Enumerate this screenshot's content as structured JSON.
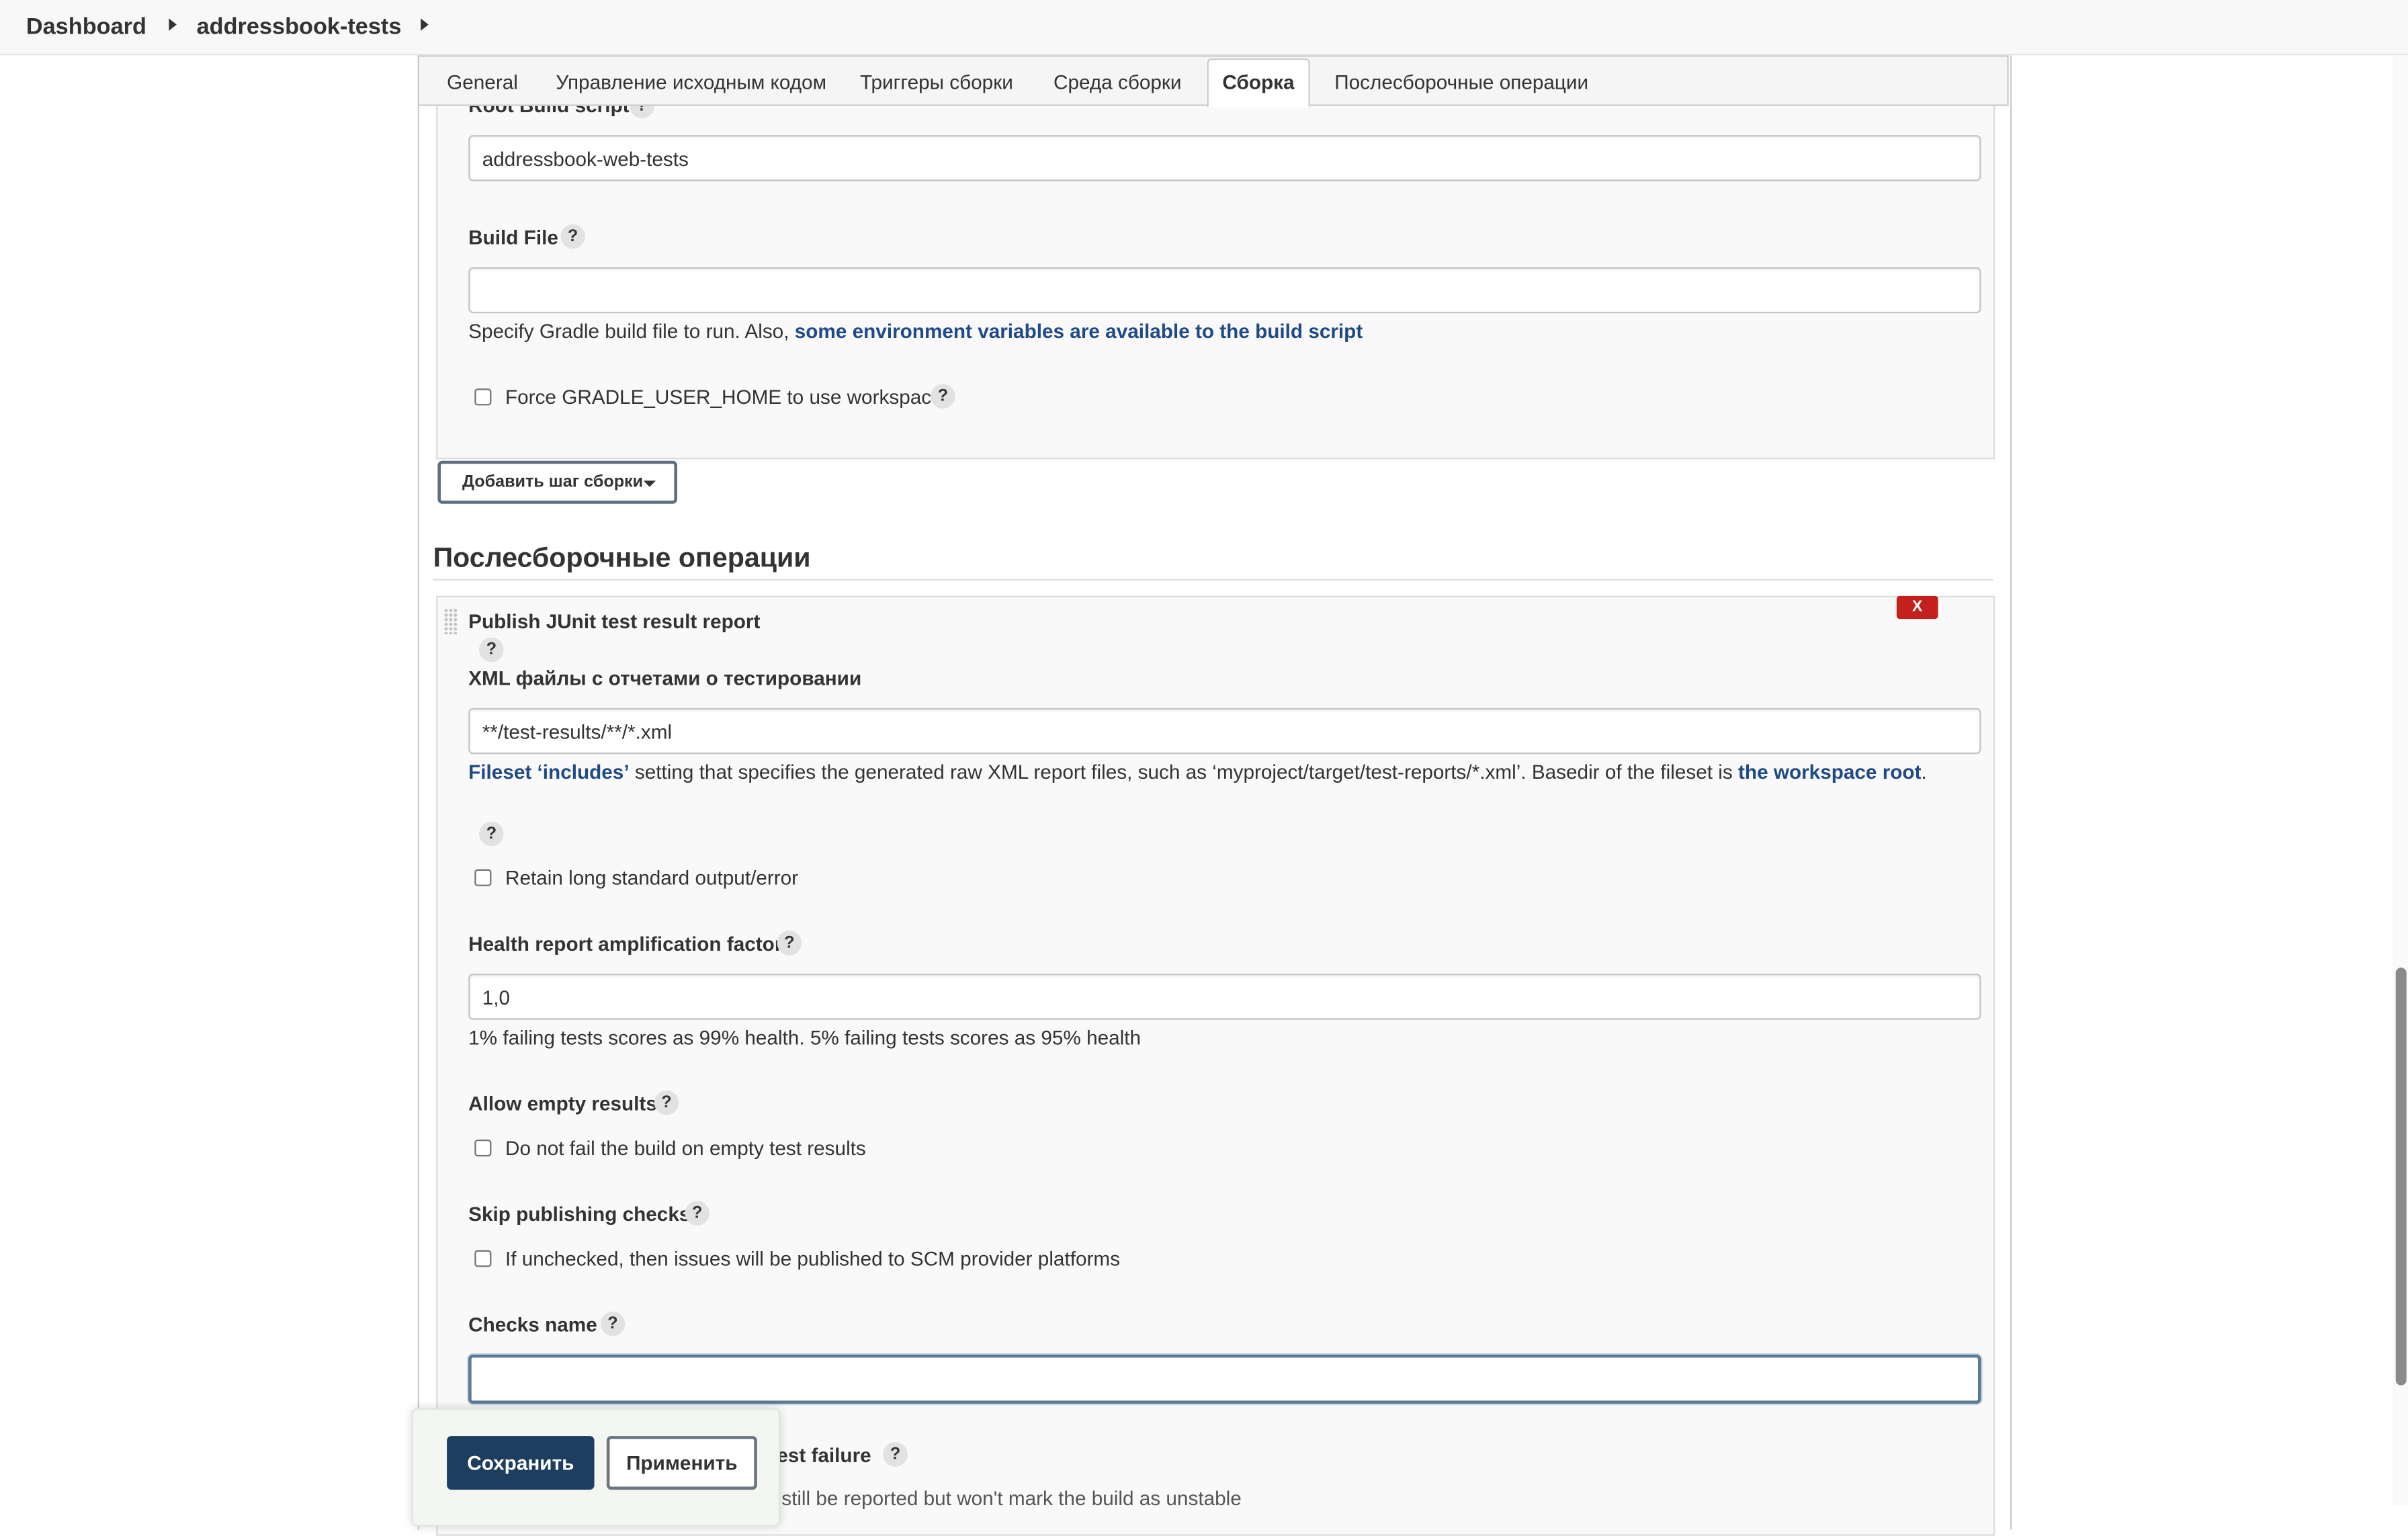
{
  "breadcrumb": {
    "items": [
      "Dashboard",
      "addressbook-tests"
    ]
  },
  "tabs": [
    {
      "label": "General"
    },
    {
      "label": "Управление исходным кодом"
    },
    {
      "label": "Триггеры сборки"
    },
    {
      "label": "Среда сборки"
    },
    {
      "label": "Сборка",
      "active": true
    },
    {
      "label": "Послесборочные операции"
    }
  ],
  "build": {
    "root_build_script_label": "Root Build script",
    "root_build_script_value": "addressbook-web-tests",
    "build_file_label": "Build File",
    "build_file_value": "",
    "build_file_desc_prefix": "Specify Gradle build file to run. Also, ",
    "build_file_desc_link": "some environment variables are available to the build script",
    "force_gradle_home_label": "Force GRADLE_USER_HOME to use workspace",
    "force_gradle_home_checked": false,
    "add_step_label": "Добавить шаг сборки"
  },
  "post_build": {
    "section_title": "Послесборочные операции",
    "delete_label": "X",
    "step_title": "Publish JUnit test result report",
    "xml_files_label": "XML файлы с отчетами о тестировании",
    "xml_files_value": "**/test-results/**/*.xml",
    "xml_desc_link1": "Fileset ‘includes’",
    "xml_desc_middle": " setting that specifies the generated raw XML report files, such as ‘myproject/target/test-reports/*.xml’. Basedir of the fileset is ",
    "xml_desc_link2": "the workspace root",
    "xml_desc_end": ".",
    "retain_output_label": "Retain long standard output/error",
    "retain_output_checked": false,
    "health_factor_label": "Health report amplification factor",
    "health_factor_value": "1,0",
    "health_factor_desc": "1% failing tests scores as 99% health. 5% failing tests scores as 95% health",
    "allow_empty_label": "Allow empty results",
    "allow_empty_checkbox_label": "Do not fail the build on empty test results",
    "allow_empty_checked": false,
    "skip_checks_label": "Skip publishing checks",
    "skip_checks_checkbox_label": "If unchecked, then issues will be published to SCM provider platforms",
    "skip_checks_checked": false,
    "checks_name_label": "Checks name",
    "checks_name_value": "",
    "unstable_label_partial": "n test failure",
    "unstable_desc_partial": "If checked, the test failures will still be reported but won't mark the build as unstable"
  },
  "help_glyph": "?",
  "actions": {
    "save_label": "Сохранить",
    "apply_label": "Применить"
  },
  "colors": {
    "link": "#204a87",
    "save_button": "#1d3e5e",
    "delete_button": "#c4201d"
  }
}
